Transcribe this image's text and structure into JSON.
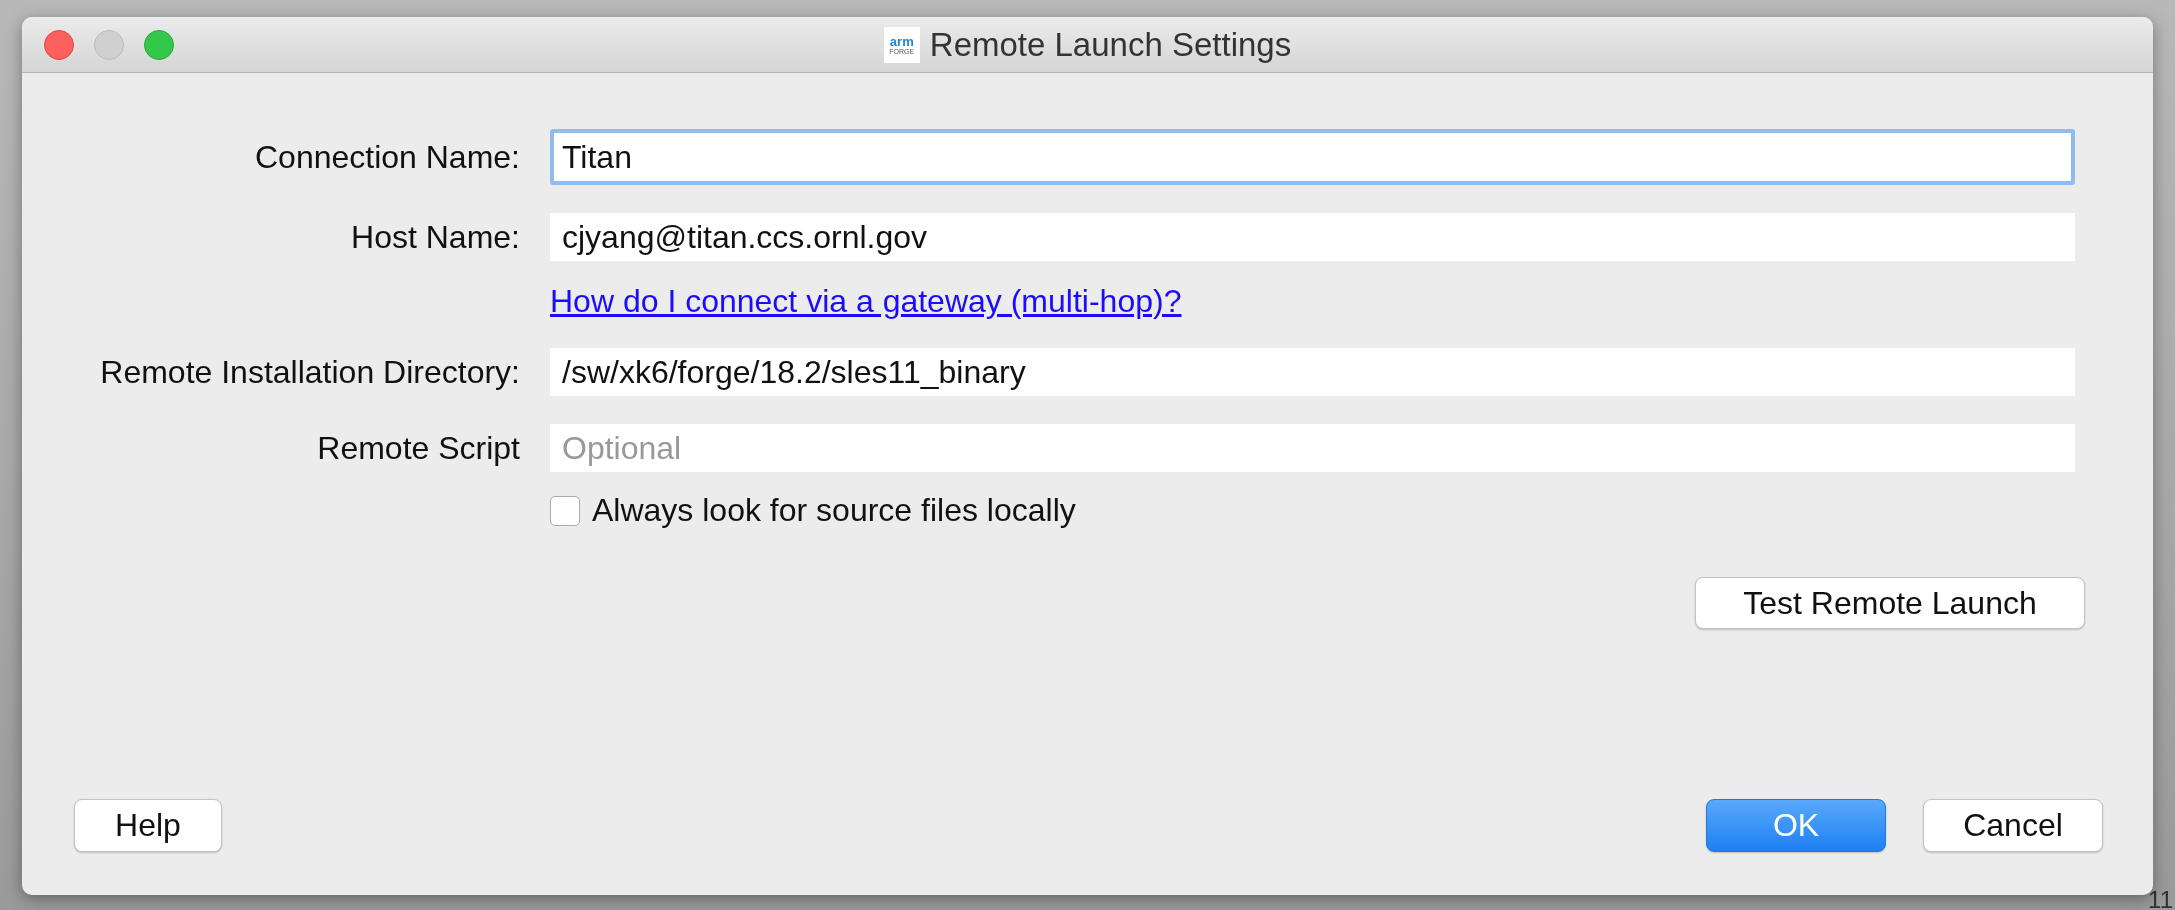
{
  "window": {
    "title": "Remote Launch Settings",
    "logo": {
      "top": "arm",
      "bottom": "FORGE"
    },
    "traffic_lights": [
      {
        "kind": "close",
        "color": "#fc605c"
      },
      {
        "kind": "minimize",
        "color": "#d0d0d0"
      },
      {
        "kind": "zoom",
        "color": "#34c84a"
      }
    ]
  },
  "form": {
    "fields": [
      {
        "label": "Connection Name:",
        "value": "Titan",
        "focused": true
      },
      {
        "label": "Host Name:",
        "value": "cjyang@titan.ccs.ornl.gov",
        "focused": false
      },
      {
        "kind": "link",
        "text": "How do I connect via a gateway (multi-hop)?"
      },
      {
        "label": "Remote Installation Directory:",
        "value": "/sw/xk6/forge/18.2/sles11_binary",
        "focused": false
      },
      {
        "label": "Remote Script",
        "placeholder": "Optional",
        "focused": false
      }
    ],
    "checkbox": {
      "label": "Always look for source files locally",
      "checked": false
    },
    "test_button": "Test Remote Launch"
  },
  "buttons": [
    {
      "label": "Help",
      "default": false
    },
    {
      "label": "OK",
      "default": true
    },
    {
      "label": "Cancel",
      "default": false
    }
  ],
  "background_text": "11"
}
